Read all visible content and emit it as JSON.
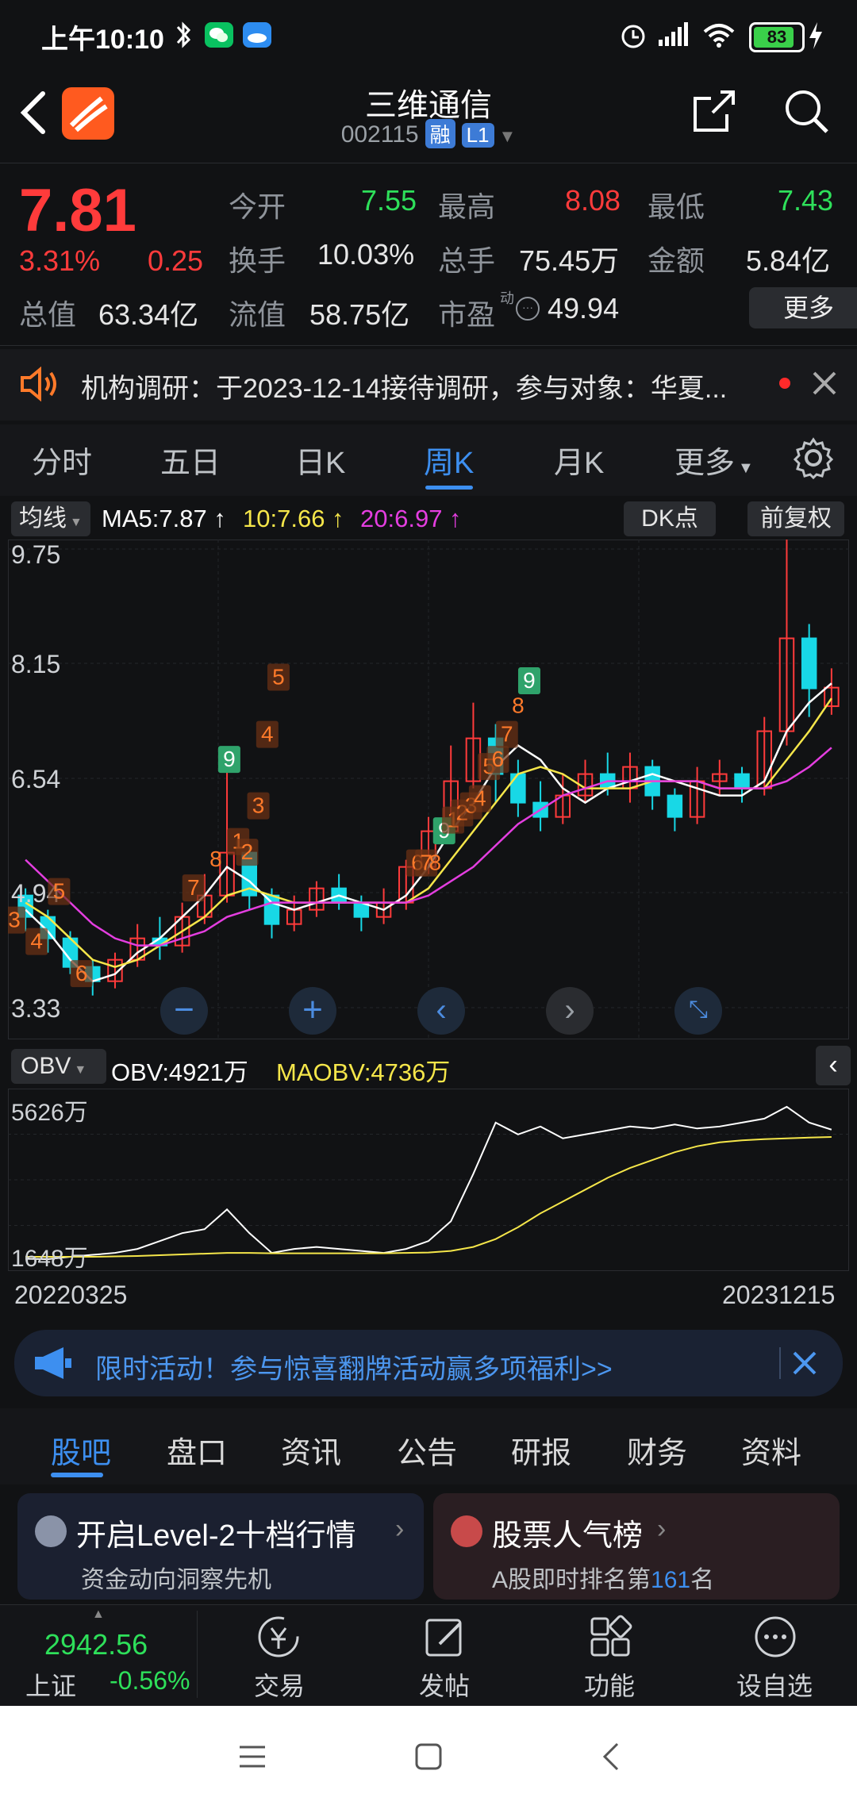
{
  "status": {
    "time": "上午10:10",
    "battery": "83"
  },
  "header": {
    "name": "三维通信",
    "code": "002115",
    "tag_rong": "融",
    "tag_level": "L1"
  },
  "quote": {
    "price": "7.81",
    "change_pct": "3.31%",
    "change": "0.25",
    "labels": {
      "open": "今开",
      "high": "最高",
      "low": "最低",
      "turnover_rate": "换手",
      "volume": "总手",
      "amount": "金额",
      "mkt_cap": "总值",
      "float_cap": "流值",
      "pe": "市盈",
      "pe_sup": "动"
    },
    "values": {
      "open": "7.55",
      "high": "8.08",
      "low": "7.43",
      "turnover_rate": "10.03%",
      "volume": "75.45万",
      "amount": "5.84亿",
      "mkt_cap": "63.34亿",
      "float_cap": "58.75亿",
      "pe": "49.94"
    },
    "more_button": "更多"
  },
  "notice": {
    "text": "机构调研：于2023-12-14接待调研，参与对象：华夏..."
  },
  "chart_tabs": [
    "分时",
    "五日",
    "日K",
    "周K",
    "月K",
    "更多"
  ],
  "ma_bar": {
    "selector": "均线",
    "ma5": "MA5:7.87",
    "ma10": "10:7.66",
    "ma20": "20:6.97",
    "dk": "DK点",
    "adjust": "前复权"
  },
  "obv_bar": {
    "selector": "OBV",
    "obv": "OBV:4921万",
    "maobv": "MAOBV:4736万"
  },
  "colors": {
    "up": "#ff3b3b",
    "down": "#18d8e6",
    "ma5": "#ffffff",
    "ma10": "#f5e64a",
    "ma20": "#e43ee0",
    "accent": "#3d8ff0"
  },
  "chart_data": [
    {
      "type": "line",
      "ylim": [
        3.33,
        9.75
      ],
      "y_ticks": [
        "9.75",
        "8.15",
        "6.54",
        "4.94",
        "3.33"
      ],
      "x_labels": [
        "20220325",
        "20231215"
      ],
      "series": [
        {
          "name": "MA5",
          "values": [
            4.7,
            4.4,
            4.0,
            3.7,
            3.8,
            4.1,
            4.3,
            4.6,
            4.9,
            5.3,
            5.1,
            4.8,
            4.7,
            4.8,
            4.9,
            4.8,
            4.7,
            4.9,
            5.3,
            5.8,
            6.2,
            6.7,
            7.0,
            6.8,
            6.4,
            6.2,
            6.4,
            6.5,
            6.6,
            6.5,
            6.4,
            6.3,
            6.3,
            6.5,
            7.2,
            7.6,
            7.87
          ]
        },
        {
          "name": "10",
          "values": [
            4.8,
            4.6,
            4.3,
            4.0,
            3.9,
            4.0,
            4.2,
            4.4,
            4.6,
            4.9,
            5.0,
            4.9,
            4.8,
            4.8,
            4.8,
            4.8,
            4.8,
            4.8,
            5.0,
            5.4,
            5.8,
            6.2,
            6.6,
            6.7,
            6.6,
            6.4,
            6.4,
            6.4,
            6.5,
            6.5,
            6.5,
            6.4,
            6.4,
            6.4,
            6.8,
            7.2,
            7.66
          ]
        },
        {
          "name": "20",
          "values": [
            5.4,
            5.1,
            4.8,
            4.5,
            4.3,
            4.2,
            4.2,
            4.3,
            4.4,
            4.6,
            4.7,
            4.8,
            4.8,
            4.8,
            4.8,
            4.8,
            4.8,
            4.8,
            4.9,
            5.1,
            5.3,
            5.6,
            5.9,
            6.1,
            6.3,
            6.4,
            6.5,
            6.5,
            6.5,
            6.5,
            6.5,
            6.4,
            6.4,
            6.4,
            6.5,
            6.7,
            6.97
          ]
        }
      ],
      "candles": [
        {
          "o": 4.9,
          "c": 4.6,
          "h": 5.0,
          "l": 4.4
        },
        {
          "o": 4.6,
          "c": 4.3,
          "h": 4.7,
          "l": 4.1
        },
        {
          "o": 4.3,
          "c": 3.9,
          "h": 4.4,
          "l": 3.8
        },
        {
          "o": 3.9,
          "c": 3.7,
          "h": 4.0,
          "l": 3.5
        },
        {
          "o": 3.7,
          "c": 4.0,
          "h": 4.1,
          "l": 3.6
        },
        {
          "o": 4.0,
          "c": 4.3,
          "h": 4.5,
          "l": 3.9
        },
        {
          "o": 4.3,
          "c": 4.2,
          "h": 4.6,
          "l": 4.0
        },
        {
          "o": 4.2,
          "c": 4.6,
          "h": 4.8,
          "l": 4.1
        },
        {
          "o": 4.6,
          "c": 4.9,
          "h": 5.2,
          "l": 4.5
        },
        {
          "o": 4.9,
          "c": 5.5,
          "h": 6.7,
          "l": 4.8
        },
        {
          "o": 5.5,
          "c": 4.9,
          "h": 5.6,
          "l": 4.7
        },
        {
          "o": 4.9,
          "c": 4.5,
          "h": 5.0,
          "l": 4.3
        },
        {
          "o": 4.5,
          "c": 4.7,
          "h": 4.9,
          "l": 4.4
        },
        {
          "o": 4.7,
          "c": 5.0,
          "h": 5.1,
          "l": 4.6
        },
        {
          "o": 5.0,
          "c": 4.8,
          "h": 5.2,
          "l": 4.7
        },
        {
          "o": 4.8,
          "c": 4.6,
          "h": 4.9,
          "l": 4.4
        },
        {
          "o": 4.6,
          "c": 4.8,
          "h": 5.0,
          "l": 4.5
        },
        {
          "o": 4.8,
          "c": 5.3,
          "h": 5.4,
          "l": 4.7
        },
        {
          "o": 5.3,
          "c": 5.8,
          "h": 6.0,
          "l": 5.2
        },
        {
          "o": 5.8,
          "c": 6.5,
          "h": 7.0,
          "l": 5.7
        },
        {
          "o": 6.5,
          "c": 7.1,
          "h": 7.6,
          "l": 6.4
        },
        {
          "o": 7.1,
          "c": 6.6,
          "h": 7.3,
          "l": 6.2
        },
        {
          "o": 6.6,
          "c": 6.2,
          "h": 6.8,
          "l": 6.0
        },
        {
          "o": 6.2,
          "c": 6.0,
          "h": 6.5,
          "l": 5.8
        },
        {
          "o": 6.0,
          "c": 6.3,
          "h": 6.6,
          "l": 5.9
        },
        {
          "o": 6.3,
          "c": 6.6,
          "h": 6.8,
          "l": 6.2
        },
        {
          "o": 6.6,
          "c": 6.4,
          "h": 6.9,
          "l": 6.3
        },
        {
          "o": 6.4,
          "c": 6.7,
          "h": 6.9,
          "l": 6.2
        },
        {
          "o": 6.7,
          "c": 6.3,
          "h": 6.8,
          "l": 6.1
        },
        {
          "o": 6.3,
          "c": 6.0,
          "h": 6.4,
          "l": 5.8
        },
        {
          "o": 6.0,
          "c": 6.5,
          "h": 6.7,
          "l": 5.9
        },
        {
          "o": 6.5,
          "c": 6.6,
          "h": 6.8,
          "l": 6.3
        },
        {
          "o": 6.6,
          "c": 6.4,
          "h": 6.7,
          "l": 6.2
        },
        {
          "o": 6.4,
          "c": 7.2,
          "h": 7.4,
          "l": 6.3
        },
        {
          "o": 7.2,
          "c": 8.5,
          "h": 9.9,
          "l": 7.0
        },
        {
          "o": 8.5,
          "c": 7.8,
          "h": 8.7,
          "l": 7.4
        },
        {
          "o": 7.55,
          "c": 7.81,
          "h": 8.08,
          "l": 7.43
        }
      ],
      "labels_tdx": [
        "3",
        "4",
        "5",
        "6",
        "7",
        "8",
        "9",
        "1",
        "2",
        "3",
        "4",
        "5",
        "6",
        "7",
        "8",
        "9",
        "1",
        "2",
        "3",
        "4",
        "5",
        "6",
        "7",
        "8",
        "9"
      ]
    },
    {
      "type": "line",
      "y_ticks": [
        "5626万",
        "1648万"
      ],
      "series": [
        {
          "name": "OBV",
          "values": [
            1650,
            1640,
            1700,
            1750,
            1800,
            1900,
            2100,
            2300,
            2400,
            2900,
            2300,
            1800,
            1900,
            1950,
            1900,
            1850,
            1800,
            1900,
            2100,
            2600,
            3800,
            5100,
            4800,
            5000,
            4700,
            4800,
            4900,
            5000,
            4950,
            5050,
            4950,
            5000,
            5100,
            5200,
            5500,
            5100,
            4921
          ]
        },
        {
          "name": "MAOBV",
          "values": [
            1700,
            1700,
            1700,
            1700,
            1710,
            1720,
            1740,
            1760,
            1780,
            1800,
            1800,
            1790,
            1790,
            1790,
            1790,
            1790,
            1790,
            1800,
            1810,
            1850,
            1950,
            2150,
            2450,
            2800,
            3100,
            3400,
            3700,
            3950,
            4150,
            4350,
            4500,
            4600,
            4650,
            4680,
            4700,
            4720,
            4736
          ]
        }
      ]
    }
  ],
  "banner": {
    "text": "限时活动！参与惊喜翻牌活动赢多项福利>>"
  },
  "news_tabs": [
    "股吧",
    "盘口",
    "资讯",
    "公告",
    "研报",
    "财务",
    "资料"
  ],
  "cards": [
    {
      "title": "开启Level-2十档行情",
      "sub": "资金动向洞察先机"
    },
    {
      "title": "股票人气榜",
      "sub_prefix": "A股即时排名第",
      "rank": "161",
      "sub_suffix": "名"
    }
  ],
  "bottom": {
    "index_value": "2942.56",
    "index_name": "上证",
    "index_change": "-0.56%",
    "items": [
      "交易",
      "发帖",
      "功能",
      "设自选"
    ]
  }
}
